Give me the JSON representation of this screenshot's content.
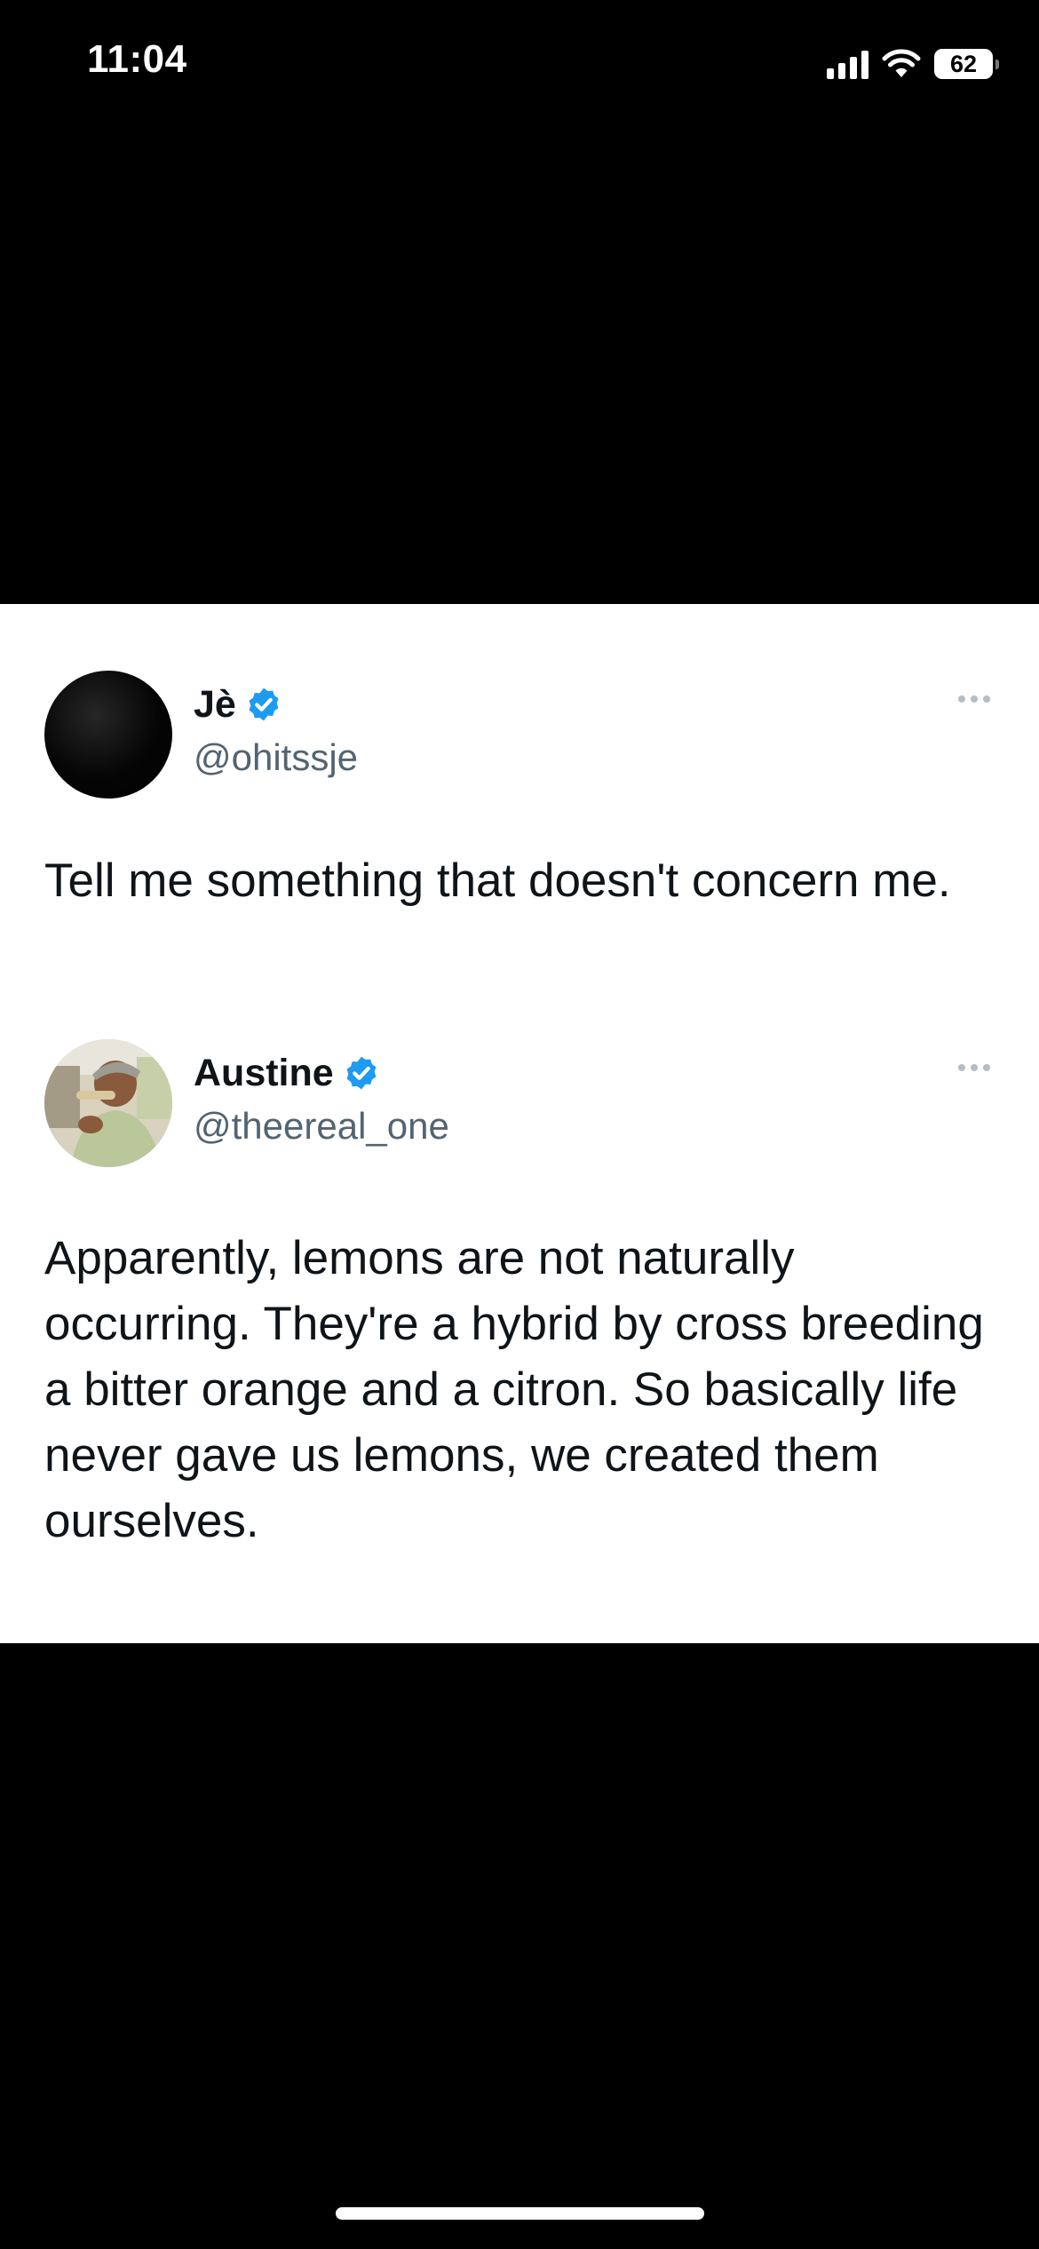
{
  "status_bar": {
    "time": "11:04",
    "battery_level": "62",
    "icons": [
      "signal-icon",
      "wifi-icon",
      "battery-icon"
    ]
  },
  "tweets": [
    {
      "display_name": "Jè",
      "handle": "@ohitssje",
      "text": "Tell me something that doesn't concern me.",
      "verified": true,
      "avatar": "dark-circle"
    },
    {
      "display_name": "Austine",
      "handle": "@theereal_one",
      "text": "Apparently, lemons are not naturally occurring. They're a hybrid by cross breeding a bitter orange and a citron. So basically life never gave us lemons, we created them ourselves.",
      "verified": true,
      "avatar": "photo-person-in-cap"
    }
  ],
  "colors": {
    "background": "#000000",
    "card": "#ffffff",
    "text_primary": "#0f1419",
    "text_secondary": "#536471",
    "verified_blue": "#1d9bf0",
    "more_dots": "#b6bdc4"
  }
}
